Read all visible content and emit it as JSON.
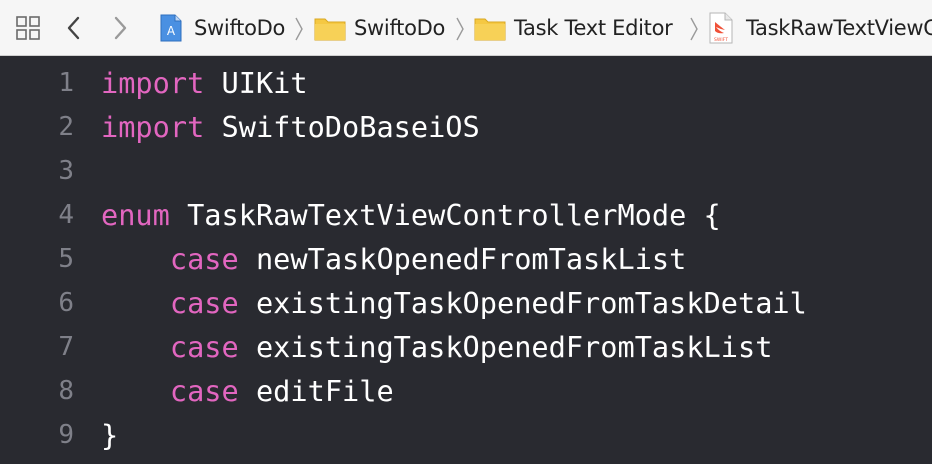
{
  "jumpbar": {
    "crumbs": [
      {
        "label": "SwiftoDo",
        "icon": "xcode-project-icon"
      },
      {
        "label": "SwiftoDo",
        "icon": "folder-icon"
      },
      {
        "label": "Task Text Editor",
        "icon": "folder-icon"
      },
      {
        "label": "TaskRawTextViewC",
        "icon": "swift-file-icon"
      }
    ],
    "swift_badge": "SWIFT"
  },
  "editor": {
    "lines": [
      {
        "num": "1",
        "kw": "import",
        "indent": "",
        "rest": " UIKit"
      },
      {
        "num": "2",
        "kw": "import",
        "indent": "",
        "rest": " SwiftoDoBaseiOS"
      },
      {
        "num": "3",
        "kw": "",
        "indent": "",
        "rest": ""
      },
      {
        "num": "4",
        "kw": "enum",
        "indent": "",
        "rest": " TaskRawTextViewControllerMode {"
      },
      {
        "num": "5",
        "kw": "case",
        "indent": "    ",
        "rest": " newTaskOpenedFromTaskList"
      },
      {
        "num": "6",
        "kw": "case",
        "indent": "    ",
        "rest": " existingTaskOpenedFromTaskDetail"
      },
      {
        "num": "7",
        "kw": "case",
        "indent": "    ",
        "rest": " existingTaskOpenedFromTaskList"
      },
      {
        "num": "8",
        "kw": "case",
        "indent": "    ",
        "rest": " editFile"
      },
      {
        "num": "9",
        "kw": "",
        "indent": "",
        "rest": "}"
      }
    ]
  },
  "colors": {
    "background": "#292a30",
    "keyword": "#e266c0",
    "plain": "#ffffff",
    "line_number": "#7f8089",
    "folder": "#f5c842"
  }
}
